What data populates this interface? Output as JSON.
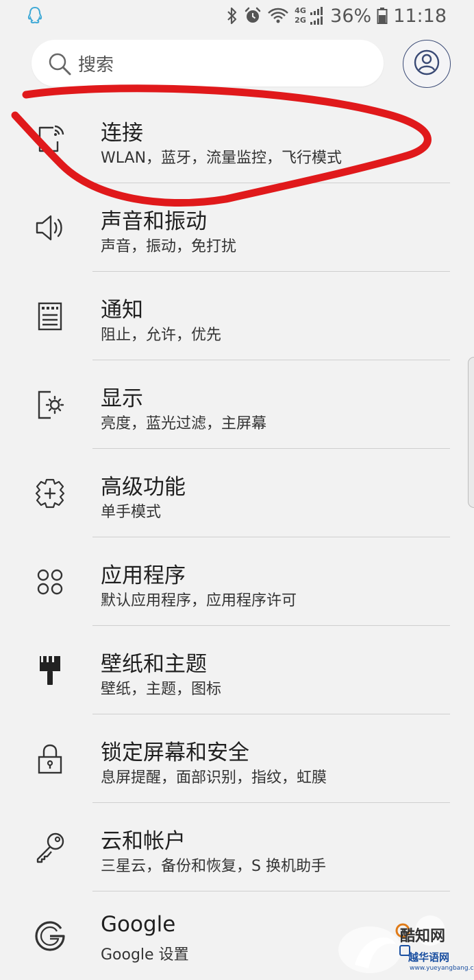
{
  "status_bar": {
    "battery": "36%",
    "time": "11:18",
    "signal_tech_top": "4G",
    "signal_tech_bottom": "2G",
    "icons": [
      "qq-icon",
      "bluetooth-icon",
      "alarm-icon",
      "wifi-icon",
      "signal-icon",
      "battery-icon"
    ]
  },
  "search": {
    "placeholder": "搜索"
  },
  "settings": {
    "items": [
      {
        "title": "连接",
        "subtitle": "WLAN，蓝牙，流量监控，飞行模式",
        "icon": "connections-icon"
      },
      {
        "title": "声音和振动",
        "subtitle": "声音，振动，免打扰",
        "icon": "speaker-icon"
      },
      {
        "title": "通知",
        "subtitle": "阻止，允许，优先",
        "icon": "notification-icon"
      },
      {
        "title": "显示",
        "subtitle": "亮度，蓝光过滤，主屏幕",
        "icon": "display-icon"
      },
      {
        "title": "高级功能",
        "subtitle": "单手模式",
        "icon": "advanced-features-icon"
      },
      {
        "title": "应用程序",
        "subtitle": "默认应用程序，应用程序许可",
        "icon": "apps-icon"
      },
      {
        "title": "壁纸和主题",
        "subtitle": "壁纸，主题，图标",
        "icon": "brush-icon"
      },
      {
        "title": "锁定屏幕和安全",
        "subtitle": "息屏提醒，面部识别，指纹，虹膜",
        "icon": "lock-icon"
      },
      {
        "title": "云和帐户",
        "subtitle": "三星云，备份和恢复，S 换机助手",
        "icon": "key-icon"
      },
      {
        "title": "Google",
        "subtitle": "Google 设置",
        "icon": "google-icon"
      }
    ]
  },
  "annotation": {
    "color": "#e0191b"
  },
  "watermark": {
    "line1": "酷知网",
    "line2": "越华语网",
    "line3": "www.yueyangbang.com"
  }
}
